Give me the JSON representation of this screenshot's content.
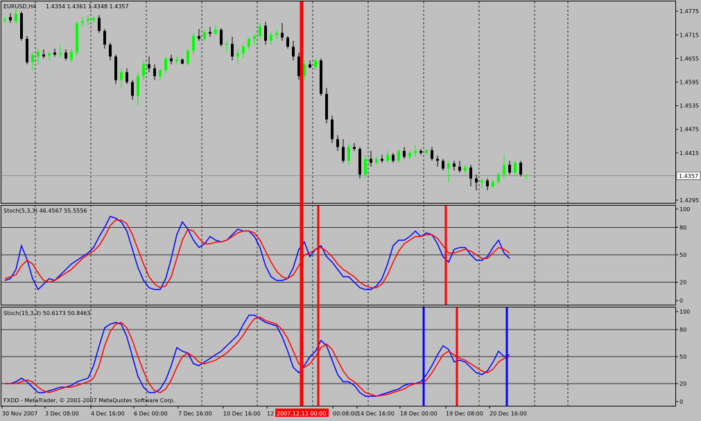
{
  "main": {
    "symbol_label": "EURUSD,H4",
    "ohlc_label": "1.4354 1.4361 1.4348 1.4357",
    "ticks": [
      {
        "label": "1.4775",
        "value": 1.4775
      },
      {
        "label": "1.4715",
        "value": 1.4715
      },
      {
        "label": "1.4655",
        "value": 1.4655
      },
      {
        "label": "1.4595",
        "value": 1.4595
      },
      {
        "label": "1.4535",
        "value": 1.4535
      },
      {
        "label": "1.4475",
        "value": 1.4475
      },
      {
        "label": "1.4415",
        "value": 1.4415
      },
      {
        "label": "1.4295",
        "value": 1.4295
      }
    ],
    "current_price_label": "1.4357",
    "current_price": 1.4357,
    "range": [
      1.4288,
      1.48
    ]
  },
  "stoch1": {
    "label": "Stoch(5,3,3) 46.4567 55.5556",
    "ticks": [
      {
        "label": "100",
        "value": 100
      },
      {
        "label": "80",
        "value": 80
      },
      {
        "label": "50",
        "value": 50
      },
      {
        "label": "20",
        "value": 20
      },
      {
        "label": "0",
        "value": 0
      }
    ],
    "levels": [
      80,
      50,
      20
    ]
  },
  "stoch2": {
    "label": "Stoch(15,3,3) 50.6173 50.8463",
    "ticks": [
      {
        "label": "100",
        "value": 100
      },
      {
        "label": "80",
        "value": 80
      },
      {
        "label": "50",
        "value": 50
      },
      {
        "label": "20",
        "value": 20
      },
      {
        "label": "0",
        "value": 0
      }
    ],
    "levels": [
      80,
      50,
      20
    ]
  },
  "copyright": "FXDD - MetaTrader, © 2001-2007 MetaQuotes Software Corp.",
  "time_labels": [
    "30 Nov 2007",
    "3 Dec 08:00",
    "4 Dec 16:00",
    "6 Dec 00:00",
    "7 Dec 16:00",
    "10 Dec 16:00",
    "12",
    "00:08:00",
    "14 Dec 16:00",
    "18 Dec 00:00",
    "19 Dec 08:00",
    "20 Dec 16:00"
  ],
  "time_cursor_label": "2007.12.13 00:00",
  "colors": {
    "background": "#c0c0c0",
    "bull": "#00ff00",
    "bear": "#000000",
    "main_line": "#0000ff",
    "signal_line": "#ff0000",
    "marker_red": "#ff0000",
    "marker_blue": "#0000ff"
  },
  "chart_data": [
    {
      "type": "candlestick",
      "title": "EURUSD,H4",
      "ylim": [
        1.4288,
        1.48
      ],
      "candles": [
        [
          1.4752,
          1.4762,
          1.4745,
          1.4755
        ],
        [
          1.476,
          1.477,
          1.4745,
          1.4752
        ],
        [
          1.475,
          1.478,
          1.474,
          1.4768
        ],
        [
          1.477,
          1.4775,
          1.47,
          1.4705
        ],
        [
          1.4705,
          1.4712,
          1.464,
          1.4645
        ],
        [
          1.4645,
          1.467,
          1.4625,
          1.4665
        ],
        [
          1.466,
          1.468,
          1.464,
          1.4672
        ],
        [
          1.4665,
          1.4678,
          1.4655,
          1.466
        ],
        [
          1.4662,
          1.467,
          1.465,
          1.4668
        ],
        [
          1.467,
          1.468,
          1.466,
          1.4665
        ],
        [
          1.4665,
          1.469,
          1.4655,
          1.4668
        ],
        [
          1.467,
          1.4678,
          1.465,
          1.4655
        ],
        [
          1.4652,
          1.468,
          1.4645,
          1.4672
        ],
        [
          1.467,
          1.475,
          1.4662,
          1.4745
        ],
        [
          1.4745,
          1.476,
          1.4735,
          1.475
        ],
        [
          1.475,
          1.4765,
          1.474,
          1.4755
        ],
        [
          1.4752,
          1.4762,
          1.4745,
          1.4758
        ],
        [
          1.4758,
          1.4765,
          1.472,
          1.4725
        ],
        [
          1.4725,
          1.473,
          1.468,
          1.469
        ],
        [
          1.469,
          1.4695,
          1.465,
          1.466
        ],
        [
          1.466,
          1.4665,
          1.459,
          1.46
        ],
        [
          1.46,
          1.463,
          1.458,
          1.462
        ],
        [
          1.462,
          1.463,
          1.459,
          1.4595
        ],
        [
          1.4595,
          1.46,
          1.455,
          1.456
        ],
        [
          1.456,
          1.462,
          1.4535,
          1.461
        ],
        [
          1.461,
          1.465,
          1.46,
          1.464
        ],
        [
          1.464,
          1.466,
          1.462,
          1.463
        ],
        [
          1.463,
          1.464,
          1.46,
          1.461
        ],
        [
          1.461,
          1.463,
          1.46,
          1.4625
        ],
        [
          1.4625,
          1.466,
          1.4615,
          1.4655
        ],
        [
          1.4655,
          1.4665,
          1.464,
          1.4648
        ],
        [
          1.4648,
          1.466,
          1.464,
          1.4652
        ],
        [
          1.4652,
          1.4655,
          1.464,
          1.4642
        ],
        [
          1.4642,
          1.468,
          1.4635,
          1.4675
        ],
        [
          1.4675,
          1.472,
          1.4665,
          1.4712
        ],
        [
          1.4712,
          1.473,
          1.47,
          1.4705
        ],
        [
          1.4705,
          1.4728,
          1.4698,
          1.4722
        ],
        [
          1.4722,
          1.4735,
          1.471,
          1.4718
        ],
        [
          1.4718,
          1.474,
          1.4715,
          1.4728
        ],
        [
          1.4728,
          1.4732,
          1.4685,
          1.469
        ],
        [
          1.469,
          1.47,
          1.467,
          1.4692
        ],
        [
          1.4692,
          1.471,
          1.465,
          1.466
        ],
        [
          1.466,
          1.468,
          1.464,
          1.4668
        ],
        [
          1.4668,
          1.469,
          1.4655,
          1.4685
        ],
        [
          1.4685,
          1.471,
          1.4675,
          1.4705
        ],
        [
          1.4705,
          1.4718,
          1.469,
          1.4712
        ],
        [
          1.4712,
          1.4745,
          1.4705,
          1.4738
        ],
        [
          1.4738,
          1.4748,
          1.469,
          1.47
        ],
        [
          1.47,
          1.4722,
          1.469,
          1.4715
        ],
        [
          1.4715,
          1.4728,
          1.4705,
          1.472
        ],
        [
          1.472,
          1.4745,
          1.47,
          1.4708
        ],
        [
          1.4708,
          1.4712,
          1.468,
          1.4685
        ],
        [
          1.4685,
          1.47,
          1.465,
          1.466
        ],
        [
          1.466,
          1.467,
          1.46,
          1.461
        ],
        [
          1.461,
          1.465,
          1.46,
          1.464
        ],
        [
          1.464,
          1.465,
          1.463,
          1.4632
        ],
        [
          1.4632,
          1.4655,
          1.4625,
          1.465
        ],
        [
          1.465,
          1.4655,
          1.456,
          1.4565
        ],
        [
          1.4565,
          1.458,
          1.449,
          1.45
        ],
        [
          1.45,
          1.451,
          1.444,
          1.445
        ],
        [
          1.445,
          1.446,
          1.442,
          1.443
        ],
        [
          1.443,
          1.445,
          1.439,
          1.4395
        ],
        [
          1.4395,
          1.444,
          1.4385,
          1.443
        ],
        [
          1.443,
          1.444,
          1.442,
          1.4425
        ],
        [
          1.4425,
          1.443,
          1.435,
          1.436
        ],
        [
          1.436,
          1.441,
          1.435,
          1.44
        ],
        [
          1.44,
          1.442,
          1.438,
          1.439
        ],
        [
          1.439,
          1.4405,
          1.4385,
          1.44
        ],
        [
          1.44,
          1.441,
          1.439,
          1.4395
        ],
        [
          1.4395,
          1.442,
          1.439,
          1.441
        ],
        [
          1.441,
          1.4415,
          1.439,
          1.4395
        ],
        [
          1.4395,
          1.4425,
          1.439,
          1.442
        ],
        [
          1.442,
          1.443,
          1.44,
          1.4405
        ],
        [
          1.4405,
          1.442,
          1.4398,
          1.4415
        ],
        [
          1.4415,
          1.4435,
          1.4405,
          1.442
        ],
        [
          1.442,
          1.4425,
          1.441,
          1.4415
        ],
        [
          1.4415,
          1.4425,
          1.441,
          1.4422
        ],
        [
          1.4422,
          1.443,
          1.4395,
          1.44
        ],
        [
          1.44,
          1.4408,
          1.438,
          1.4395
        ],
        [
          1.4395,
          1.44,
          1.437,
          1.4375
        ],
        [
          1.4375,
          1.4395,
          1.434,
          1.4388
        ],
        [
          1.4388,
          1.4395,
          1.437,
          1.438
        ],
        [
          1.438,
          1.4395,
          1.4365,
          1.437
        ],
        [
          1.437,
          1.4385,
          1.436,
          1.4378
        ],
        [
          1.4378,
          1.4385,
          1.433,
          1.435
        ],
        [
          1.435,
          1.436,
          1.432,
          1.434
        ],
        [
          1.434,
          1.435,
          1.4325,
          1.4345
        ],
        [
          1.4345,
          1.435,
          1.432,
          1.433
        ],
        [
          1.433,
          1.4345,
          1.4325,
          1.4342
        ],
        [
          1.4342,
          1.4365,
          1.4335,
          1.436
        ],
        [
          1.436,
          1.441,
          1.435,
          1.4385
        ],
        [
          1.4385,
          1.4395,
          1.436,
          1.4365
        ],
        [
          1.4365,
          1.4395,
          1.4355,
          1.439
        ],
        [
          1.439,
          1.4395,
          1.4355,
          1.436
        ],
        [
          1.4356,
          1.4361,
          1.4348,
          1.4357
        ]
      ]
    },
    {
      "type": "line",
      "title": "Stoch(5,3,3) 46.4567 55.5556",
      "ylim": [
        0,
        100
      ],
      "series": [
        {
          "values": [
            22,
            24,
            34,
            60,
            45,
            24,
            12,
            18,
            24,
            22,
            28,
            34,
            40,
            44,
            48,
            52,
            58,
            70,
            80,
            92,
            90,
            86,
            76,
            56,
            36,
            22,
            14,
            12,
            12,
            24,
            46,
            72,
            86,
            78,
            66,
            58,
            62,
            70,
            66,
            64,
            66,
            72,
            78,
            76,
            76,
            70,
            58,
            38,
            26,
            22,
            22,
            24,
            36,
            56,
            64,
            48,
            56,
            60,
            48,
            42,
            34,
            26,
            26,
            20,
            14,
            12,
            12,
            16,
            24,
            40,
            60,
            66,
            66,
            70,
            76,
            70,
            74,
            72,
            62,
            48,
            42,
            56,
            58,
            58,
            50,
            44,
            44,
            48,
            58,
            66,
            52,
            46
          ]
        },
        {
          "values": [
            24,
            26,
            28,
            38,
            44,
            40,
            30,
            22,
            20,
            22,
            26,
            30,
            34,
            40,
            46,
            50,
            54,
            60,
            70,
            82,
            88,
            88,
            84,
            72,
            56,
            40,
            26,
            18,
            14,
            16,
            26,
            46,
            66,
            78,
            76,
            68,
            62,
            62,
            64,
            64,
            66,
            70,
            74,
            76,
            76,
            74,
            66,
            54,
            42,
            32,
            26,
            24,
            28,
            38,
            50,
            52,
            56,
            58,
            54,
            48,
            40,
            34,
            30,
            26,
            20,
            16,
            14,
            14,
            18,
            28,
            42,
            54,
            62,
            66,
            70,
            70,
            72,
            72,
            68,
            60,
            52,
            52,
            54,
            56,
            54,
            50,
            46,
            46,
            52,
            58,
            56,
            52
          ]
        }
      ]
    },
    {
      "type": "line",
      "title": "Stoch(15,3,3) 50.6173 50.8463",
      "ylim": [
        0,
        100
      ],
      "series": [
        {
          "values": [
            20,
            20,
            22,
            26,
            22,
            16,
            10,
            10,
            12,
            14,
            16,
            16,
            18,
            22,
            24,
            26,
            40,
            62,
            82,
            86,
            88,
            86,
            72,
            50,
            28,
            16,
            10,
            10,
            14,
            24,
            40,
            60,
            56,
            54,
            42,
            40,
            44,
            48,
            52,
            56,
            62,
            68,
            74,
            86,
            96,
            96,
            92,
            88,
            86,
            84,
            72,
            56,
            38,
            32,
            40,
            50,
            56,
            68,
            62,
            46,
            30,
            22,
            22,
            18,
            10,
            6,
            6,
            6,
            8,
            10,
            12,
            14,
            18,
            20,
            20,
            22,
            30,
            40,
            52,
            62,
            58,
            44,
            46,
            44,
            38,
            32,
            30,
            34,
            44,
            56,
            50,
            52
          ]
        },
        {
          "values": [
            20,
            20,
            20,
            22,
            24,
            22,
            16,
            12,
            10,
            12,
            14,
            16,
            16,
            18,
            20,
            22,
            26,
            40,
            62,
            78,
            86,
            88,
            82,
            68,
            50,
            34,
            20,
            12,
            10,
            14,
            24,
            38,
            50,
            54,
            50,
            44,
            42,
            44,
            46,
            50,
            54,
            60,
            66,
            74,
            84,
            92,
            94,
            90,
            88,
            86,
            80,
            70,
            56,
            42,
            38,
            42,
            50,
            60,
            64,
            58,
            46,
            34,
            26,
            22,
            16,
            10,
            8,
            6,
            7,
            8,
            10,
            12,
            14,
            18,
            20,
            20,
            24,
            32,
            42,
            52,
            56,
            52,
            48,
            46,
            42,
            38,
            34,
            32,
            36,
            44,
            48,
            50
          ]
        }
      ]
    }
  ]
}
